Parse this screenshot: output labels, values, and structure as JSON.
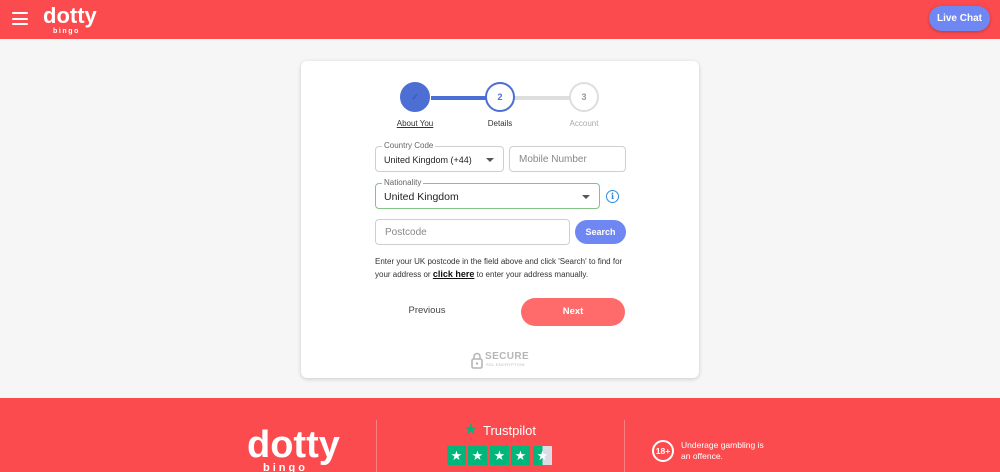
{
  "header": {
    "logo_text": "dotty",
    "logo_sub": "bingo",
    "live_chat_label": "Live Chat"
  },
  "stepper": {
    "steps": [
      {
        "label": "About You",
        "marker": "✓",
        "state": "complete"
      },
      {
        "label": "Details",
        "marker": "2",
        "state": "active"
      },
      {
        "label": "Account",
        "marker": "3",
        "state": "pending"
      }
    ]
  },
  "form": {
    "country_code": {
      "label": "Country Code",
      "value": "United Kingdom (+44)"
    },
    "mobile": {
      "placeholder": "Mobile Number"
    },
    "nationality": {
      "label": "Nationality",
      "value": "United Kingdom"
    },
    "info_icon_text": "i",
    "postcode": {
      "placeholder": "Postcode"
    },
    "search_label": "Search",
    "helper_text_1": "Enter your UK postcode in the field above and click 'Search' to find for your address or",
    "helper_link": "click here",
    "helper_text_2": "to enter your address manually.",
    "previous_label": "Previous",
    "next_label": "Next"
  },
  "secure_badge": {
    "text": "SECURE",
    "sub": "SSL ENCRYPTION"
  },
  "footer": {
    "logo_text": "dotty",
    "logo_sub": "bingo",
    "trustpilot_label": "Trustpilot",
    "trustpilot_rating": 4.5,
    "age_badge": "18+",
    "age_text": "Underage gambling is an offence."
  },
  "colors": {
    "brand_red": "#fb4b4e",
    "accent_blue": "#6f87f2",
    "next_red": "#ff6b6b",
    "trustpilot_green": "#00b67a"
  }
}
